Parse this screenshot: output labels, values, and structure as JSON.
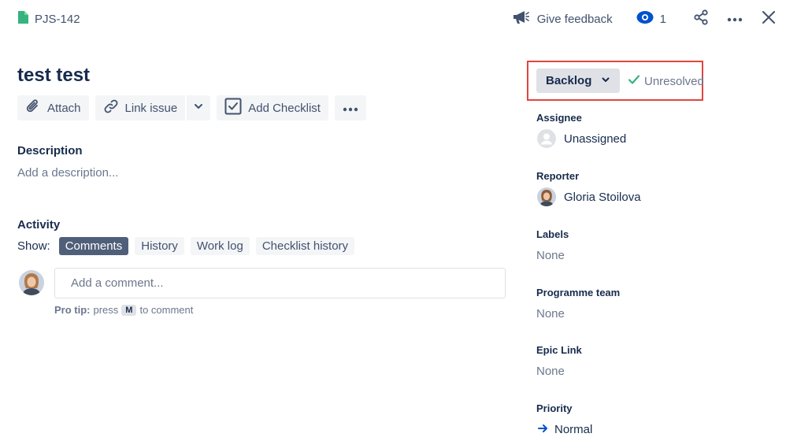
{
  "header": {
    "issue_key": "PJS-142",
    "issue_icon": "story-page-icon",
    "feedback_label": "Give feedback",
    "watch_count": "1"
  },
  "issue": {
    "title": "test test"
  },
  "toolbar": {
    "attach": "Attach",
    "link_issue": "Link issue",
    "add_checklist": "Add Checklist"
  },
  "description": {
    "heading": "Description",
    "placeholder": "Add a description..."
  },
  "activity": {
    "heading": "Activity",
    "show_label": "Show:",
    "tabs": [
      "Comments",
      "History",
      "Work log",
      "Checklist history"
    ],
    "active_tab": "Comments",
    "comment_placeholder": "Add a comment...",
    "pro_tip_bold": "Pro tip:",
    "pro_tip_press": "press",
    "pro_tip_key": "M",
    "pro_tip_rest": "to comment"
  },
  "status": {
    "value": "Backlog",
    "resolution": "Unresolved"
  },
  "fields": {
    "assignee": {
      "label": "Assignee",
      "value": "Unassigned"
    },
    "reporter": {
      "label": "Reporter",
      "value": "Gloria Stoilova"
    },
    "labels": {
      "label": "Labels",
      "value": "None"
    },
    "programme_team": {
      "label": "Programme team",
      "value": "None"
    },
    "epic_link": {
      "label": "Epic Link",
      "value": "None"
    },
    "priority": {
      "label": "Priority",
      "value": "Normal"
    }
  },
  "colors": {
    "accent": "#0052CC",
    "success": "#36B37E",
    "highlight_border": "#E0463C",
    "active_pill": "#505F79"
  }
}
